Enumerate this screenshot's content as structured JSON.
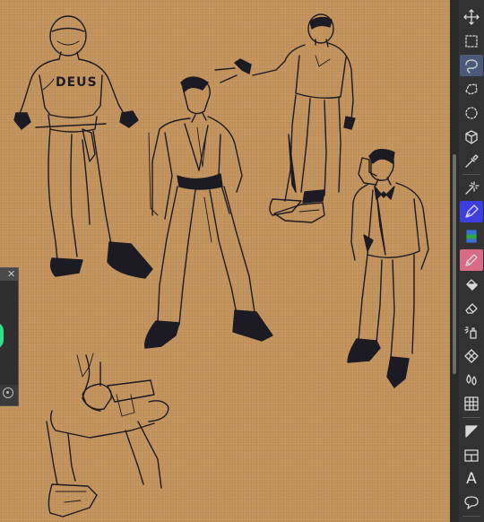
{
  "canvas": {
    "background_color": "#c4955f",
    "ink_color": "#1c1a22",
    "shirt_lettering": "DEUS"
  },
  "floating_panel": {
    "close_icon": "close-icon",
    "settings_icon": "settings-icon",
    "swatch_color": "#2ee08a"
  },
  "toolbar": {
    "tools": [
      {
        "name": "move",
        "icon": "move-icon"
      },
      {
        "name": "rectangle-select",
        "icon": "rectangle-select-icon"
      },
      {
        "name": "lasso-select",
        "icon": "lasso-icon",
        "active": true
      },
      {
        "name": "polygon-select",
        "icon": "polygon-lasso-icon"
      },
      {
        "name": "ellipse-select",
        "icon": "ellipse-select-icon"
      },
      {
        "name": "3d-object",
        "icon": "cube-icon"
      },
      {
        "name": "eyedropper",
        "icon": "eyedropper-icon"
      },
      {
        "name": "magic-wand",
        "icon": "magic-wand-icon"
      },
      {
        "name": "pen",
        "icon": "pen-icon",
        "active": true
      },
      {
        "name": "marker",
        "icon": "marker-icon"
      },
      {
        "name": "pencil",
        "icon": "pencil-icon",
        "active": true
      },
      {
        "name": "fill",
        "icon": "fill-icon"
      },
      {
        "name": "eraser",
        "icon": "eraser-icon"
      },
      {
        "name": "airbrush",
        "icon": "airbrush-icon"
      },
      {
        "name": "pattern",
        "icon": "pattern-icon"
      },
      {
        "name": "blend",
        "icon": "droplets-icon"
      },
      {
        "name": "grid",
        "icon": "grid-icon"
      },
      {
        "name": "gradient",
        "icon": "gradient-icon"
      },
      {
        "name": "panel",
        "icon": "panel-icon"
      },
      {
        "name": "text",
        "icon": "text-icon",
        "label": "A"
      },
      {
        "name": "balloon",
        "icon": "speech-balloon-icon"
      }
    ]
  }
}
